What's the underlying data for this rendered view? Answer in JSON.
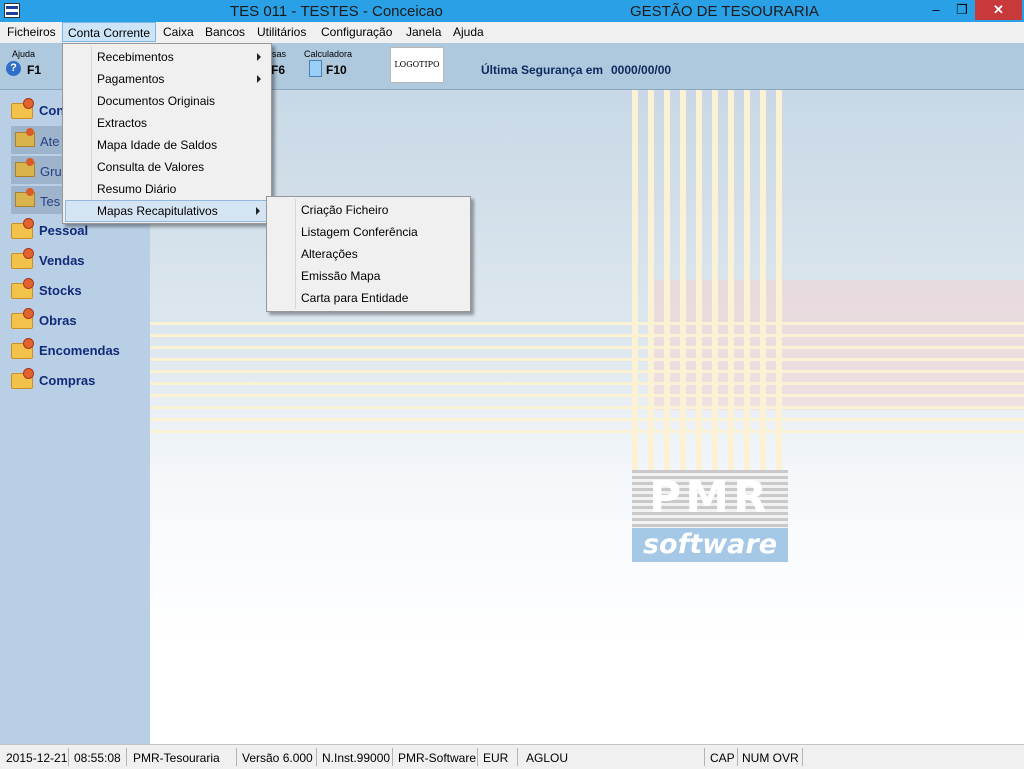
{
  "window": {
    "title": "TES 011 - TESTES - Conceicao",
    "app_name": "GESTÃO DE TESOURARIA",
    "minimize": "–",
    "restore": "❐",
    "close": "✕"
  },
  "menubar": {
    "items": [
      "Ficheiros",
      "Conta Corrente",
      "Caixa",
      "Bancos",
      "Utilitários",
      "Configuração",
      "Janela",
      "Ajuda"
    ],
    "active": "Conta Corrente"
  },
  "toolbar": {
    "help_label": "Ajuda",
    "help_key": "F1",
    "hidden_label": "sas",
    "hidden_key": "F6",
    "calc_label": "Calculadora",
    "calc_key": "F10",
    "logo_text": "LOGOTIPO",
    "backup_label": "Última Segurança em",
    "backup_value": "0000/00/00"
  },
  "sidebar": {
    "items": [
      {
        "label": "Conta Corrente",
        "visible": "Con"
      },
      {
        "label": "Ate"
      },
      {
        "label": "Gru"
      },
      {
        "label": "Tes"
      },
      {
        "label": "Pessoal"
      },
      {
        "label": "Vendas"
      },
      {
        "label": "Stocks"
      },
      {
        "label": "Obras"
      },
      {
        "label": "Encomendas"
      },
      {
        "label": "Compras"
      }
    ]
  },
  "dropdown": {
    "items": [
      {
        "label": "Recebimentos",
        "submenu": true
      },
      {
        "label": "Pagamentos",
        "submenu": true
      },
      {
        "label": "Documentos Originais",
        "submenu": false
      },
      {
        "label": "Extractos",
        "submenu": false
      },
      {
        "label": "Mapa Idade de Saldos",
        "submenu": false
      },
      {
        "label": "Consulta de Valores",
        "submenu": false
      },
      {
        "label": "Resumo Diário",
        "submenu": false
      },
      {
        "label": "Mapas  Recapitulativos",
        "submenu": true,
        "highlighted": true
      }
    ]
  },
  "submenu": {
    "items": [
      "Criação Ficheiro",
      "Listagem Conferência",
      "Alterações",
      "Emissão Mapa",
      "Carta para Entidade"
    ]
  },
  "brand": {
    "pmr": "PMR",
    "software": "software"
  },
  "statusbar": {
    "date": "2015-12-21",
    "time": "08:55:08",
    "module": "PMR-Tesouraria",
    "version": "Versão  6.000",
    "installation": "N.Inst.99000",
    "vendor": "PMR-Software",
    "currency": "EUR",
    "user": "AGLOU",
    "caps": "CAP",
    "num_ovr": "NUM OVR"
  }
}
